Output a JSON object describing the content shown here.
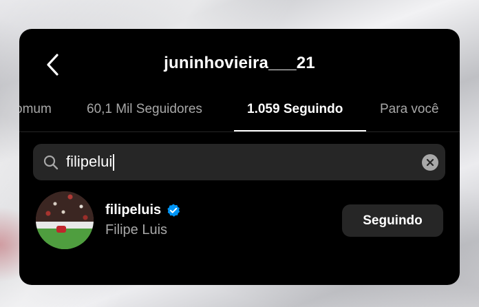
{
  "header": {
    "title": "juninhovieira___21",
    "back_icon": "chevron-left-icon"
  },
  "tabs": [
    {
      "label": "omum",
      "active": false
    },
    {
      "label": "60,1 Mil Seguidores",
      "active": false
    },
    {
      "label": "1.059 Seguindo",
      "active": true
    },
    {
      "label": "Para você",
      "active": false
    }
  ],
  "search": {
    "value": "filipelui",
    "icons": {
      "search": "search-icon",
      "clear": "clear-icon"
    }
  },
  "result": {
    "username": "filipeluis",
    "full_name": "Filipe Luis",
    "verified": true,
    "button_label": "Seguindo",
    "avatar_icon": "avatar"
  },
  "colors": {
    "background": "#000000",
    "surface": "#262626",
    "text_primary": "#ffffff",
    "text_secondary": "#a8a8a8",
    "verified_blue": "#0095f6"
  }
}
